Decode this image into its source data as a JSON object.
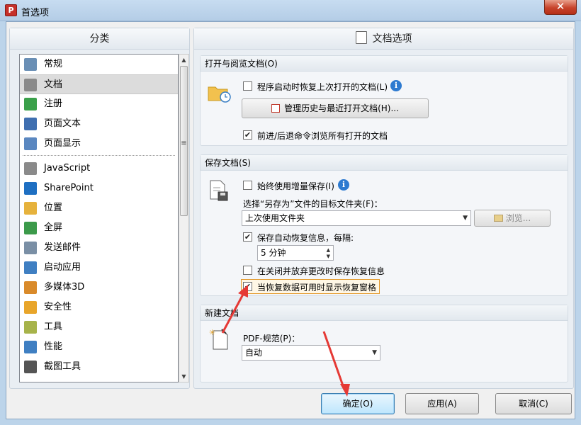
{
  "window": {
    "title": "首选项",
    "close": "✕"
  },
  "left_panel": {
    "header": "分类",
    "items": [
      {
        "label": "常规",
        "icon": "general-settings-icon",
        "color": "#6a8fb5"
      },
      {
        "label": "文档",
        "icon": "document-icon",
        "color": "#8a8a8a",
        "selected": true
      },
      {
        "label": "注册",
        "icon": "user-register-icon",
        "color": "#3aa04a"
      },
      {
        "label": "页面文本",
        "icon": "text-t-icon",
        "color": "#3f6fb0"
      },
      {
        "label": "页面显示",
        "icon": "page-zoom-icon",
        "color": "#5a87c0"
      },
      {
        "label": "JavaScript",
        "icon": "script-icon",
        "color": "#8a8a8a"
      },
      {
        "label": "SharePoint",
        "icon": "sharepoint-icon",
        "color": "#1e6fc2"
      },
      {
        "label": "位置",
        "icon": "folder-icon",
        "color": "#e6b23c"
      },
      {
        "label": "全屏",
        "icon": "fullscreen-icon",
        "color": "#3c9a4a"
      },
      {
        "label": "发送邮件",
        "icon": "mail-icon",
        "color": "#7a8fa5"
      },
      {
        "label": "启动应用",
        "icon": "launch-app-icon",
        "color": "#3f7fc2"
      },
      {
        "label": "多媒体3D",
        "icon": "multimedia-3d-icon",
        "color": "#d98a2a"
      },
      {
        "label": "安全性",
        "icon": "security-shield-icon",
        "color": "#e8a52a"
      },
      {
        "label": "工具",
        "icon": "tools-icon",
        "color": "#a7b34a"
      },
      {
        "label": "性能",
        "icon": "performance-gauge-icon",
        "color": "#3f7fc2"
      },
      {
        "label": "截图工具",
        "icon": "camera-icon",
        "color": "#555555"
      }
    ]
  },
  "right_panel": {
    "header": "文档选项",
    "group_open": {
      "title": "打开与阅览文档(O)",
      "restore_docs": {
        "label": "程序启动时恢复上次打开的文档(L)",
        "checked": false
      },
      "manage_history_button": "管理历史与最近打开文档(H)...",
      "browse_all": {
        "label": "前进/后退命令浏览所有打开的文档",
        "checked": true
      }
    },
    "group_save": {
      "title": "保存文档(S)",
      "incremental_save": {
        "label": "始终使用增量保存(I)",
        "checked": false
      },
      "save_as_folder_label": "选择“另存为”文件的目标文件夹(F)：",
      "save_as_folder_value": "上次使用文件夹",
      "browse_button": "浏览...",
      "autosave": {
        "label": "保存自动恢复信息，每隔:",
        "checked": true
      },
      "interval_value": "5 分钟",
      "save_on_close": {
        "label": "在关闭并放弃更改时保存恢复信息",
        "checked": false
      },
      "show_recovery_pane": {
        "label": "当恢复数据可用时显示恢复窗格",
        "checked": true
      }
    },
    "group_new": {
      "title": "新建文档",
      "pdf_standard_label": "PDF-规范(P)：",
      "pdf_standard_value": "自动"
    }
  },
  "footer": {
    "ok": "确定(O)",
    "apply": "应用(A)",
    "cancel": "取消(C)"
  },
  "accent_colors": {
    "annotation_arrow": "#e53935",
    "info": "#2d7ad0"
  }
}
